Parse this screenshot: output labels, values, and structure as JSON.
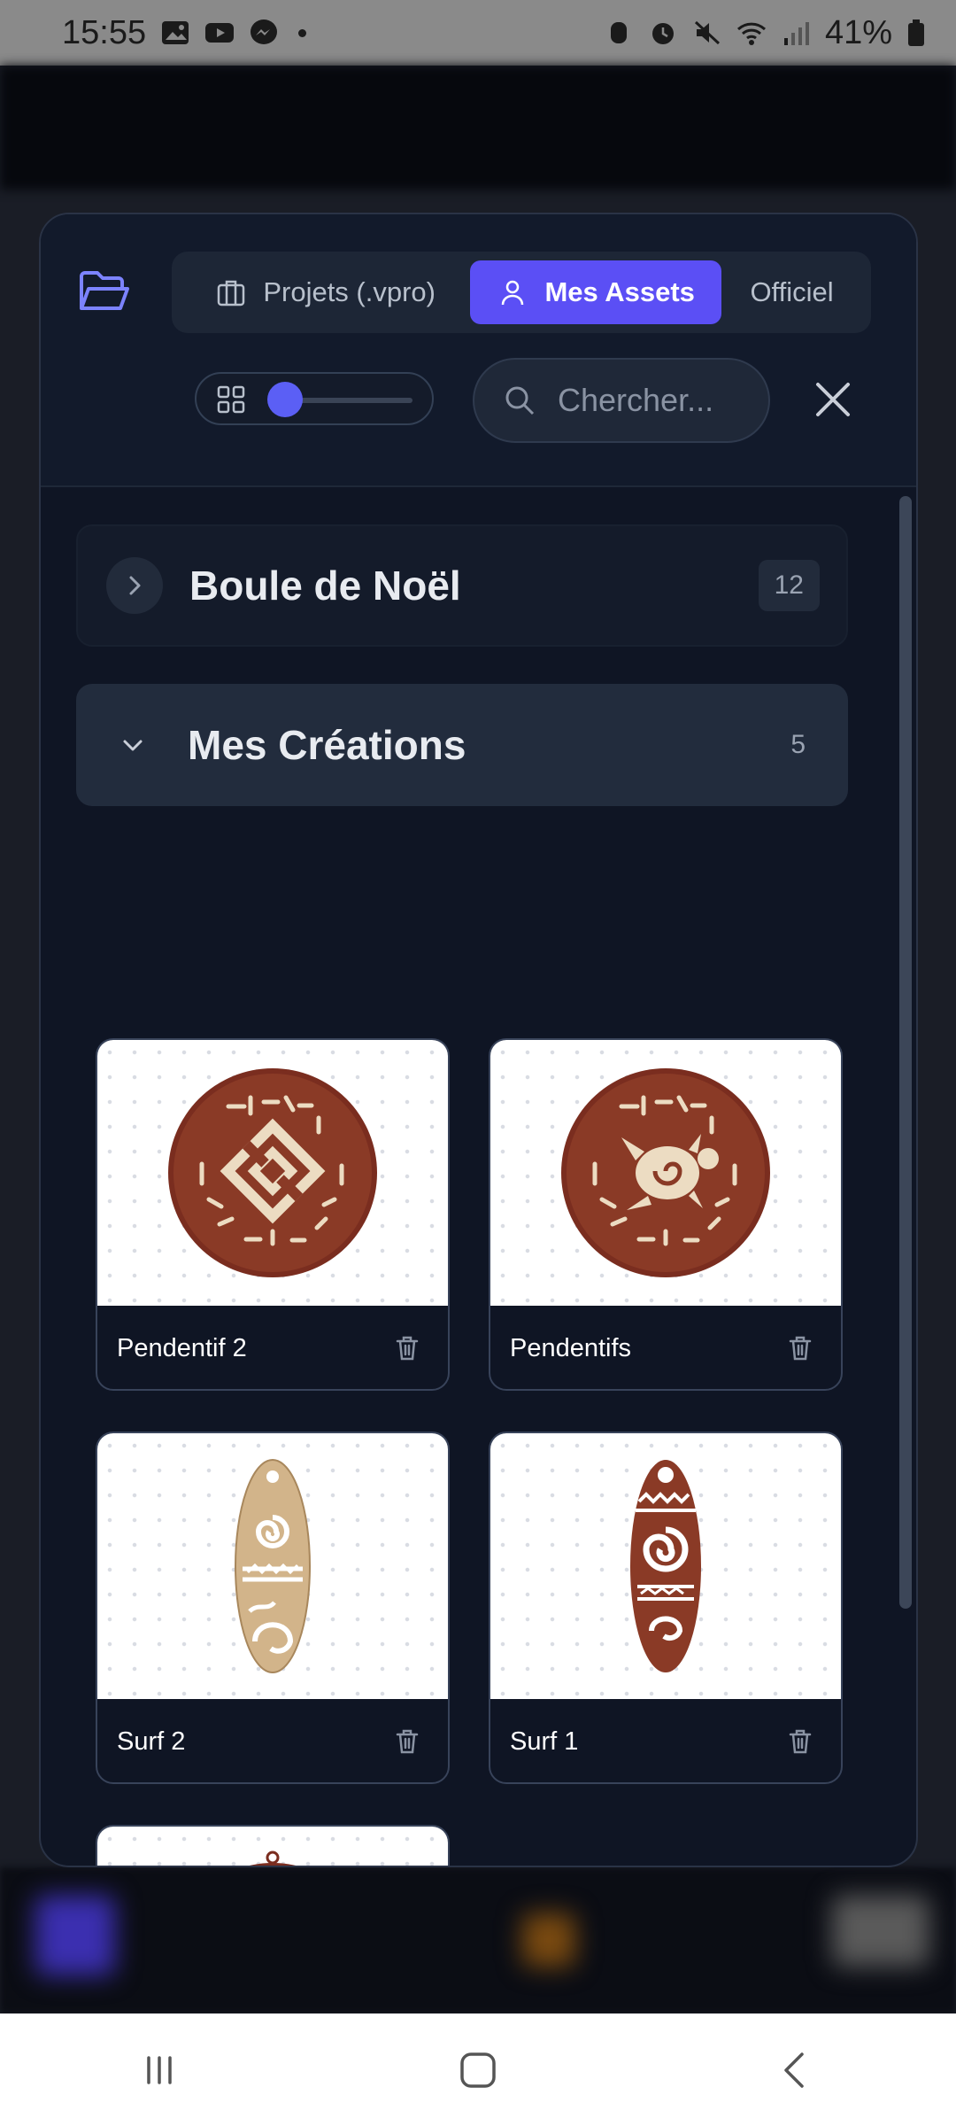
{
  "status_bar": {
    "time": "15:55",
    "battery": "41%"
  },
  "header": {
    "tabs": [
      {
        "label": "Projets (.vpro)",
        "icon": "briefcase-icon",
        "active": false
      },
      {
        "label": "Mes Assets",
        "icon": "user-icon",
        "active": true
      },
      {
        "label": "Officiel",
        "active": false
      }
    ],
    "search": {
      "placeholder": "Chercher...",
      "value": ""
    },
    "thumbnail_size_level": 0.0
  },
  "categories": [
    {
      "title": "Boule de Noël",
      "count": "12",
      "expanded": false
    },
    {
      "title": "Mes Créations",
      "count": "5",
      "expanded": true
    }
  ],
  "assets": [
    {
      "name": "Pendentif 2",
      "icon": "medallion-knot-icon"
    },
    {
      "name": "Pendentifs",
      "icon": "medallion-turtle-icon"
    },
    {
      "name": "Surf 2",
      "icon": "surfboard-light-icon"
    },
    {
      "name": "Surf 1",
      "icon": "surfboard-dark-icon"
    },
    {
      "name": "",
      "icon": "buddha-tree-icon"
    }
  ],
  "colors": {
    "accent": "#5b4ff5",
    "modal_bg": "#0f1524",
    "wood_dark": "#7a2d1f",
    "wood_light": "#d8b98c",
    "amber": "#e89416"
  }
}
